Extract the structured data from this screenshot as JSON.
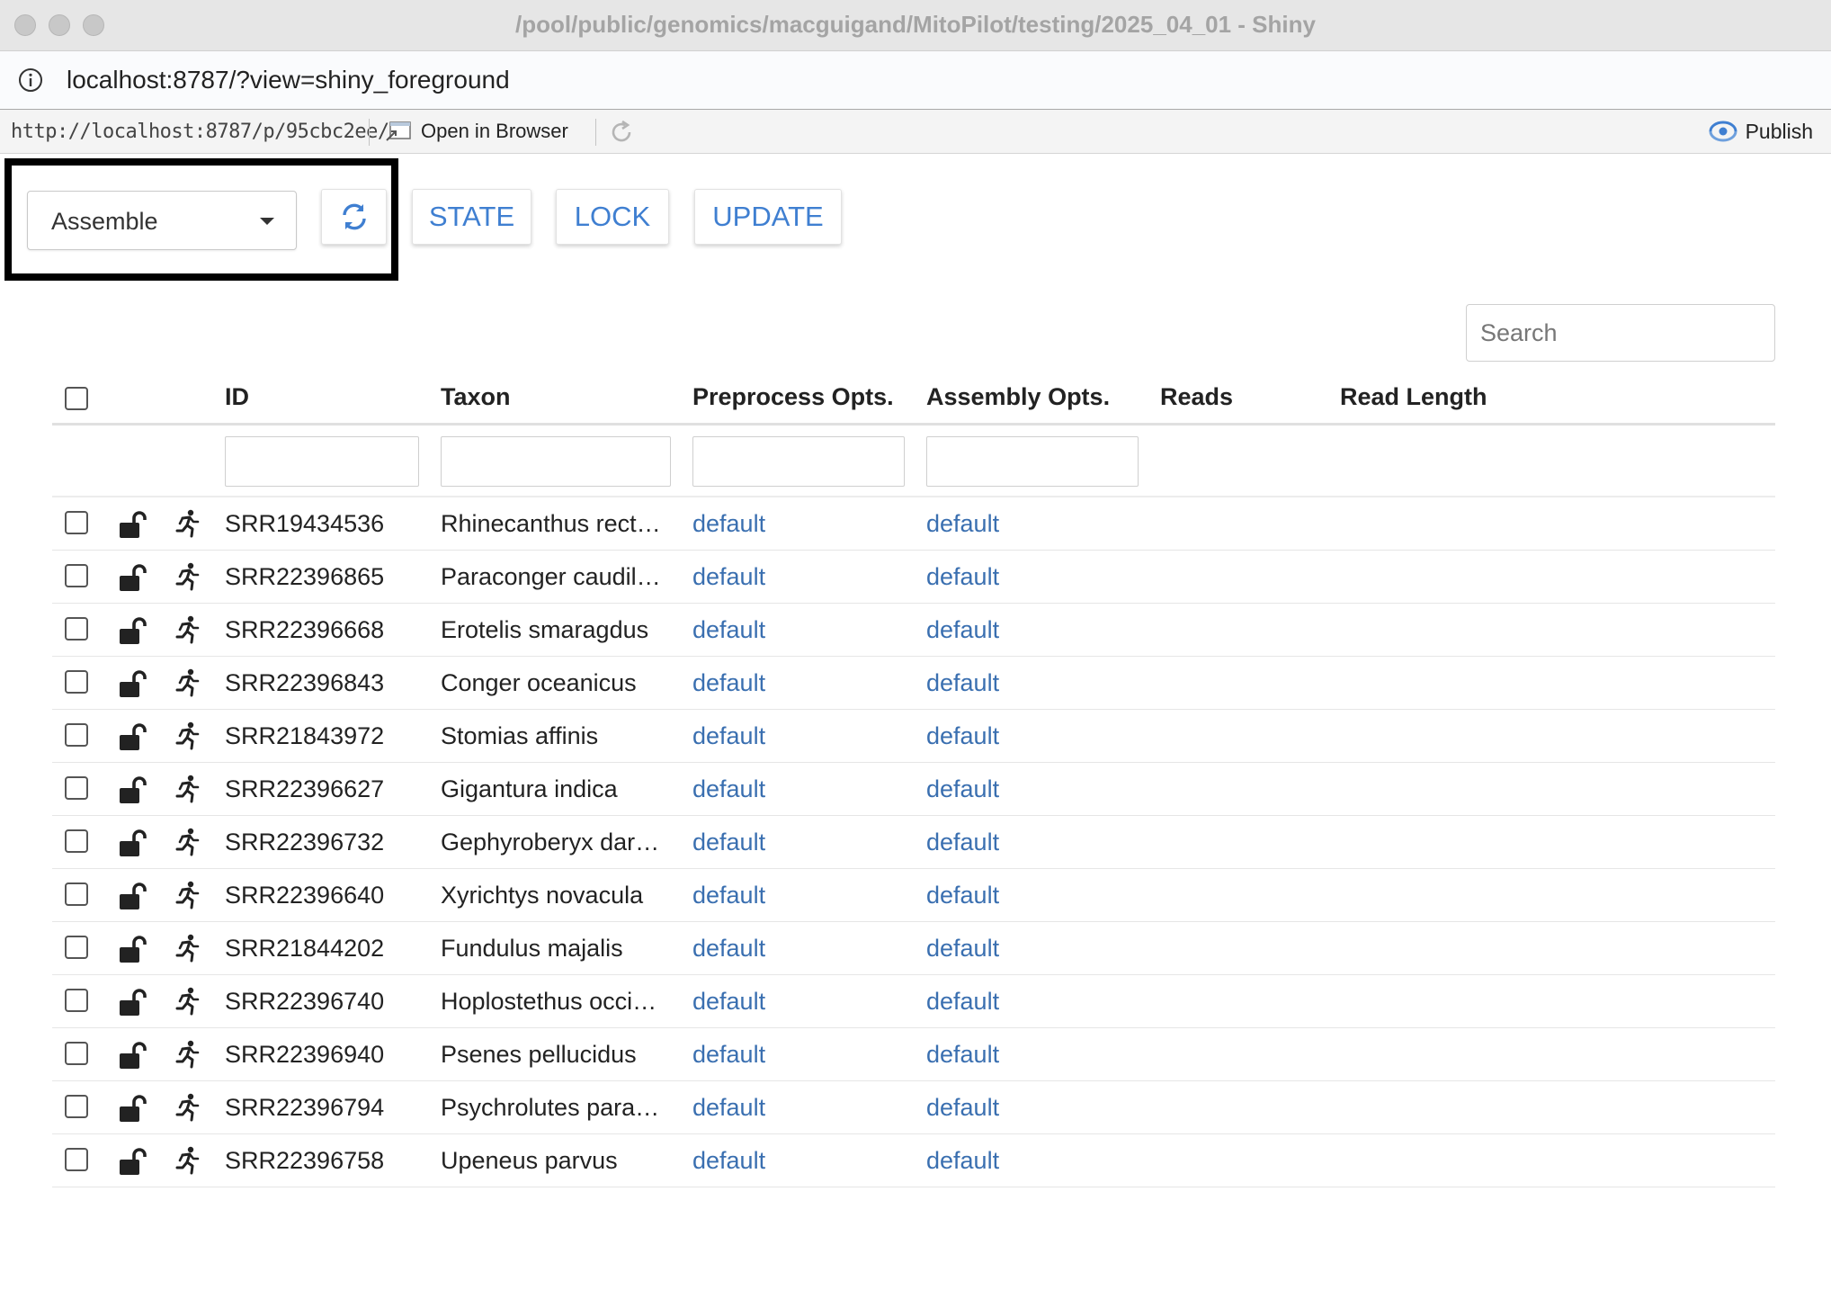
{
  "window": {
    "title": "/pool/public/genomics/macguigand/MitoPilot/testing/2025_04_01 - Shiny"
  },
  "address_bar": {
    "url": "localhost:8787/?view=shiny_foreground"
  },
  "viewer_toolbar": {
    "url": "http://localhost:8787/p/95cbc2ee/",
    "open_in_browser_label": "Open in Browser",
    "publish_label": "Publish"
  },
  "controls": {
    "mode_select_value": "Assemble",
    "state_label": "STATE",
    "lock_label": "LOCK",
    "update_label": "UPDATE",
    "search_placeholder": "Search"
  },
  "table": {
    "columns": [
      "ID",
      "Taxon",
      "Preprocess Opts.",
      "Assembly Opts.",
      "Reads",
      "Read Length"
    ],
    "rows": [
      {
        "id": "SRR19434536",
        "taxon": "Rhinecanthus rect…",
        "preprocess": "default",
        "assembly": "default"
      },
      {
        "id": "SRR22396865",
        "taxon": "Paraconger caudil…",
        "preprocess": "default",
        "assembly": "default"
      },
      {
        "id": "SRR22396668",
        "taxon": "Erotelis smaragdus",
        "preprocess": "default",
        "assembly": "default"
      },
      {
        "id": "SRR22396843",
        "taxon": "Conger oceanicus",
        "preprocess": "default",
        "assembly": "default"
      },
      {
        "id": "SRR21843972",
        "taxon": "Stomias affinis",
        "preprocess": "default",
        "assembly": "default"
      },
      {
        "id": "SRR22396627",
        "taxon": "Gigantura indica",
        "preprocess": "default",
        "assembly": "default"
      },
      {
        "id": "SRR22396732",
        "taxon": "Gephyroberyx dar…",
        "preprocess": "default",
        "assembly": "default"
      },
      {
        "id": "SRR22396640",
        "taxon": "Xyrichtys novacula",
        "preprocess": "default",
        "assembly": "default"
      },
      {
        "id": "SRR21844202",
        "taxon": "Fundulus majalis",
        "preprocess": "default",
        "assembly": "default"
      },
      {
        "id": "SRR22396740",
        "taxon": "Hoplostethus occi…",
        "preprocess": "default",
        "assembly": "default"
      },
      {
        "id": "SRR22396940",
        "taxon": "Psenes pellucidus",
        "preprocess": "default",
        "assembly": "default"
      },
      {
        "id": "SRR22396794",
        "taxon": "Psychrolutes para…",
        "preprocess": "default",
        "assembly": "default"
      },
      {
        "id": "SRR22396758",
        "taxon": "Upeneus parvus",
        "preprocess": "default",
        "assembly": "default"
      }
    ],
    "row_icons": [
      "unlocked-icon",
      "running-icon"
    ]
  },
  "colors": {
    "accent_blue": "#3f7fd1",
    "link_blue": "#3a6fb0",
    "highlight_border": "#000000"
  }
}
